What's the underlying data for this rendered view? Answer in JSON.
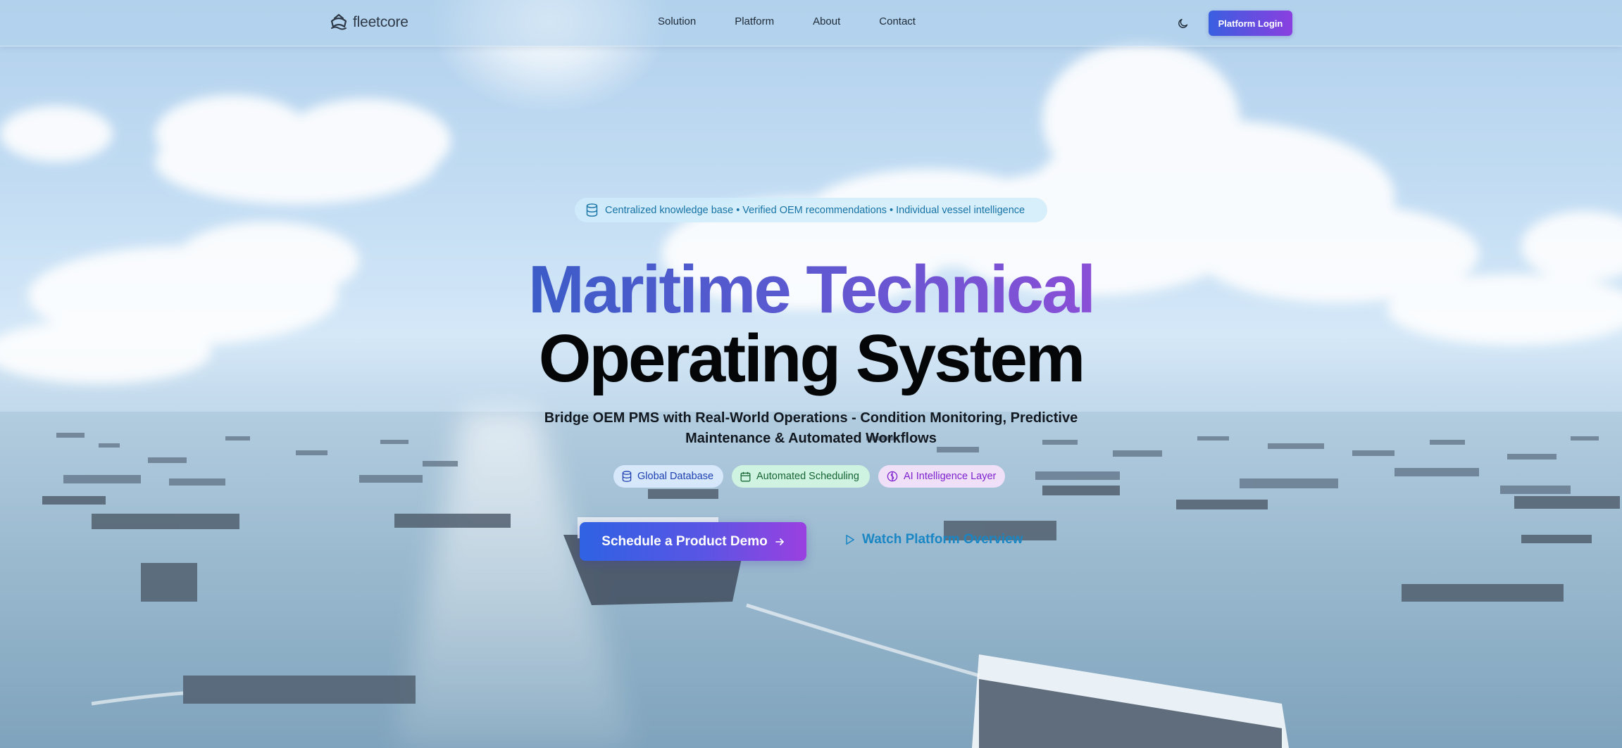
{
  "nav": {
    "brand": "fleetcore",
    "links": [
      "Solution",
      "Platform",
      "About",
      "Contact"
    ],
    "login_label": "Platform Login"
  },
  "hero": {
    "pill": "Centralized knowledge base • Verified OEM recommendations • Individual vessel intelligence",
    "title_line1": "Maritime Technical",
    "title_line2": "Operating System",
    "subtitle": "Bridge OEM PMS with Real-World Operations - Condition Monitoring, Predictive Maintenance & Automated Workflows",
    "features": [
      "Global Database",
      "Automated Scheduling",
      "AI Intelligence Layer"
    ],
    "cta_primary": "Schedule a Product Demo",
    "cta_secondary": "Watch Platform Overview"
  },
  "colors": {
    "accent_start": "#3a5fe0",
    "accent_end": "#8a3fe0",
    "link_blue": "#1a86c4"
  }
}
